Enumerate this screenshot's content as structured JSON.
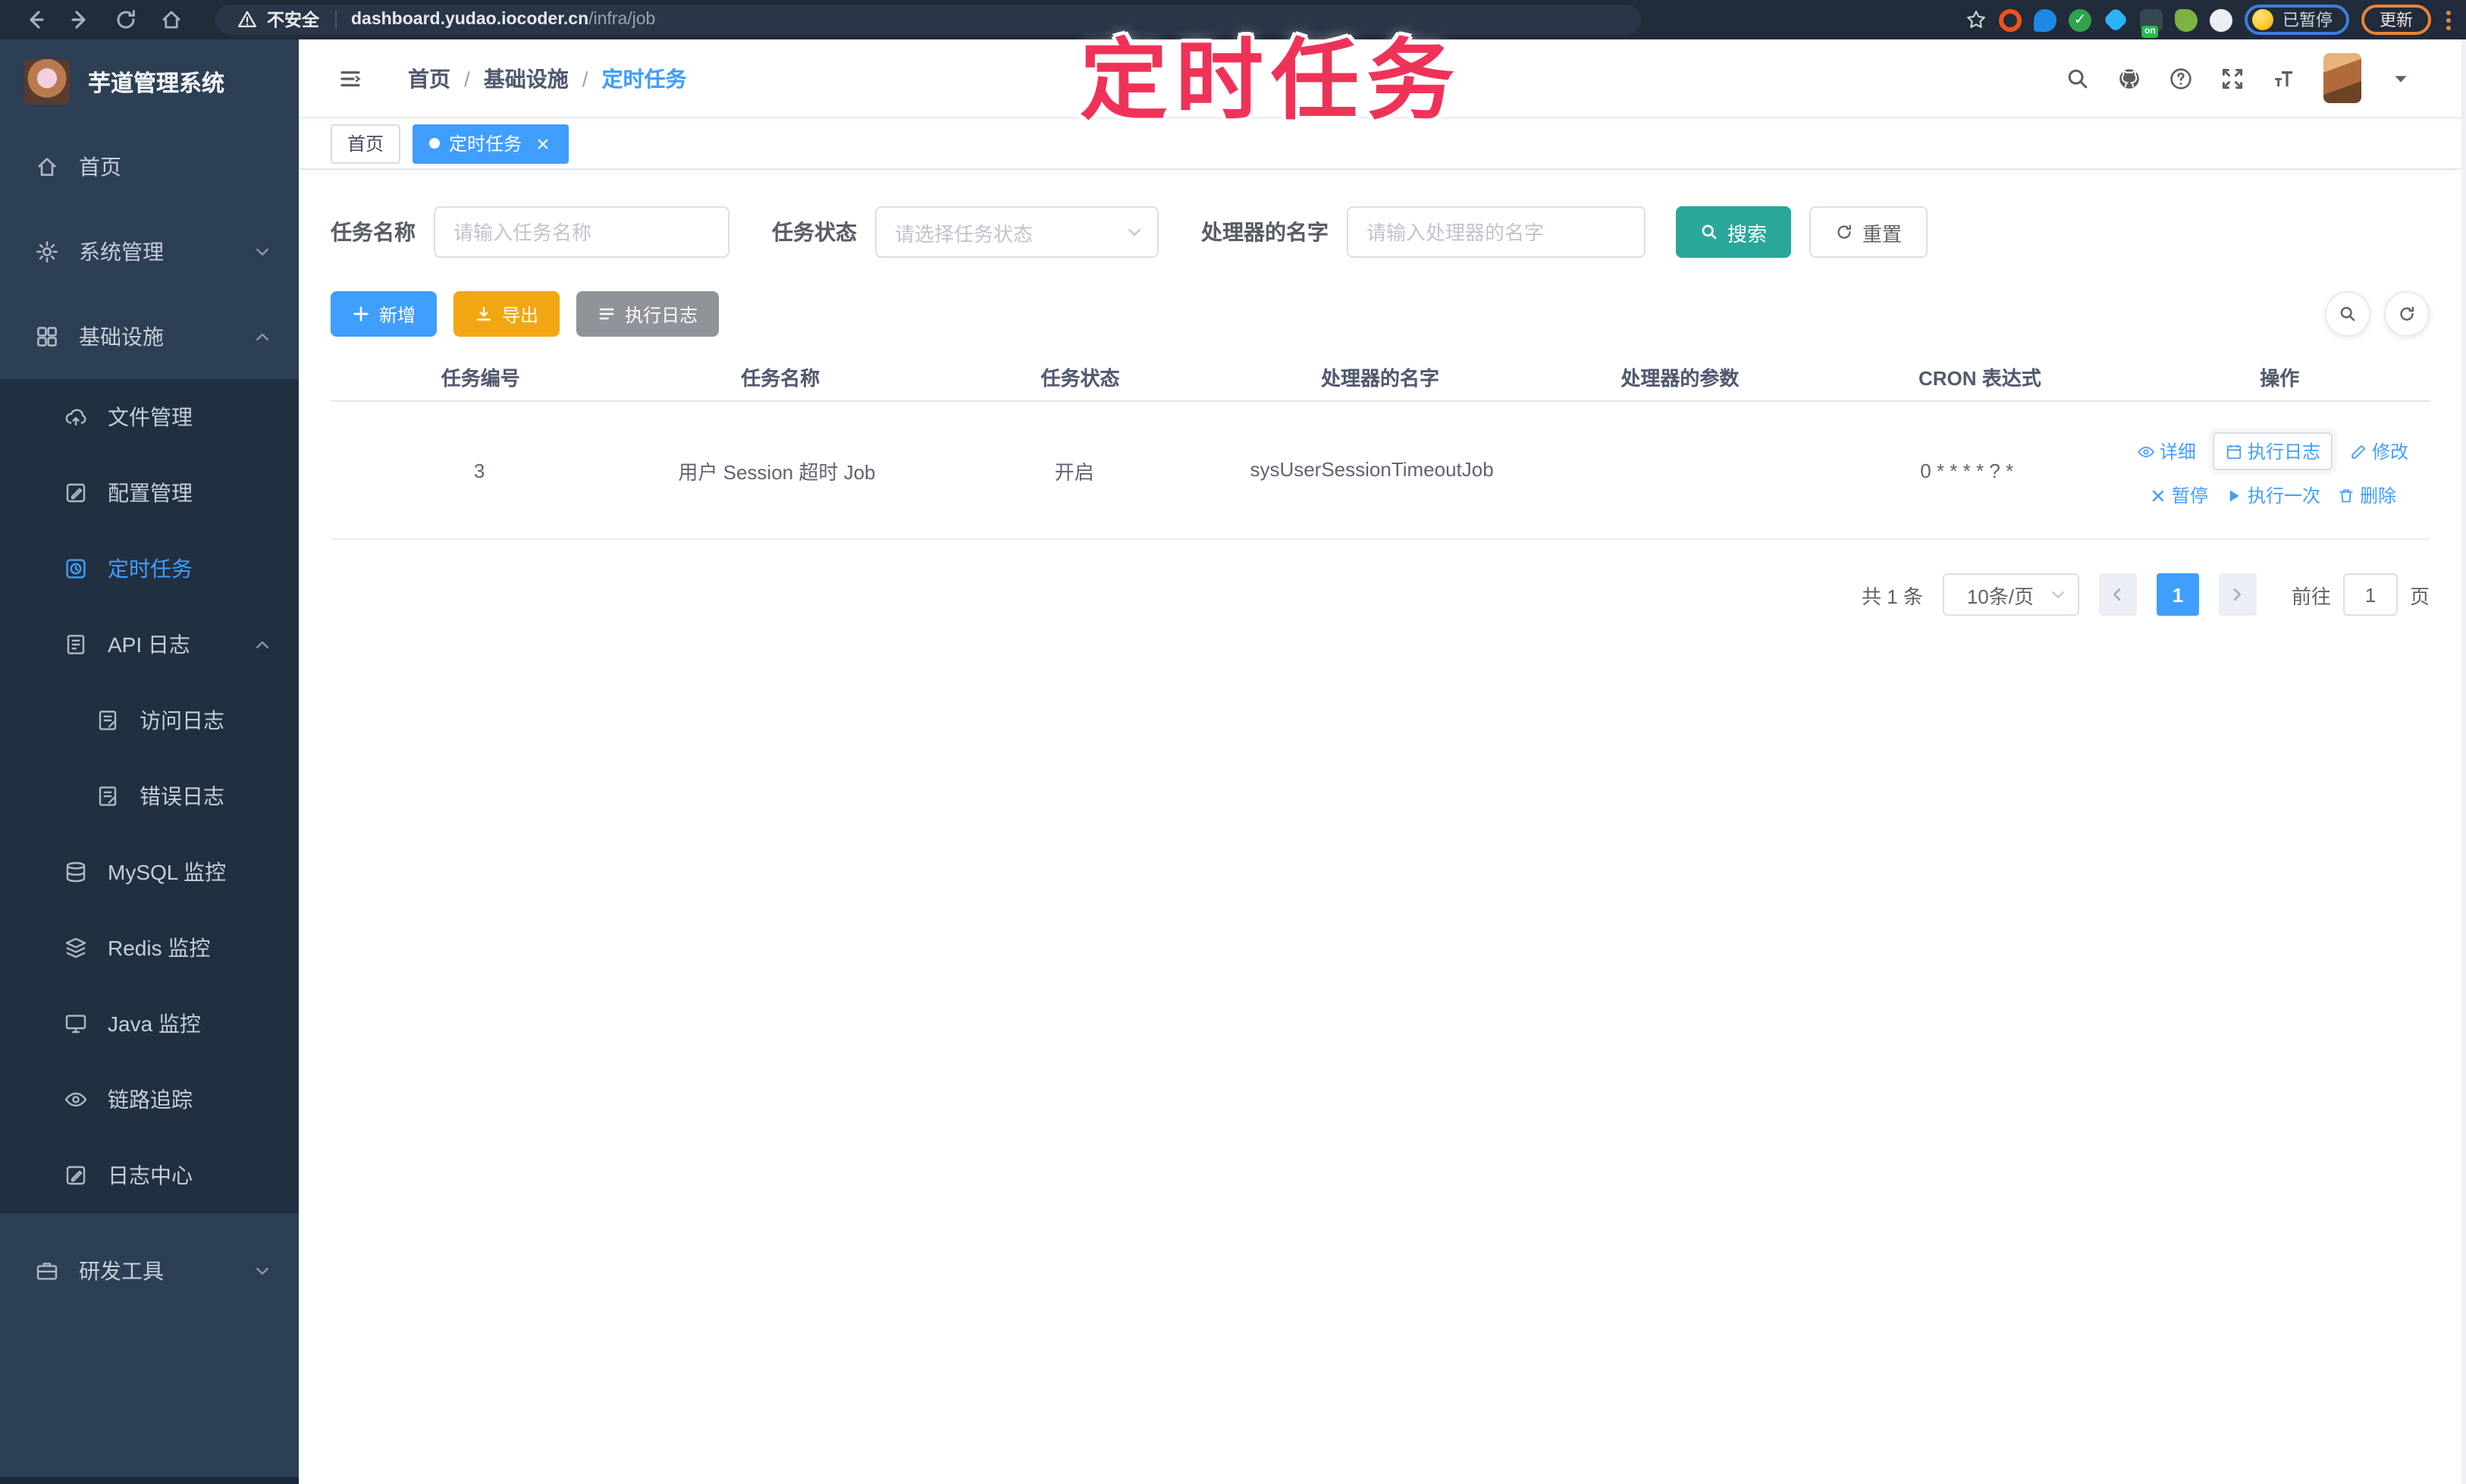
{
  "annotation": {
    "text": "定时任务",
    "color": "#ef3358"
  },
  "browser": {
    "security_label": "不安全",
    "url_host": "dashboard.yudao.iocoder.cn",
    "url_path": "/infra/job",
    "extension_on_badge": "on",
    "extension_check_glyph": "✓",
    "paused_badge": "已暂停",
    "update_button": "更新"
  },
  "sidebar": {
    "app_title": "芋道管理系统",
    "items": [
      {
        "label": "首页"
      },
      {
        "label": "系统管理"
      },
      {
        "label": "基础设施"
      },
      {
        "label": "文件管理"
      },
      {
        "label": "配置管理"
      },
      {
        "label": "定时任务"
      },
      {
        "label": "API 日志"
      },
      {
        "label": "访问日志"
      },
      {
        "label": "错误日志"
      },
      {
        "label": "MySQL 监控"
      },
      {
        "label": "Redis 监控"
      },
      {
        "label": "Java 监控"
      },
      {
        "label": "链路追踪"
      },
      {
        "label": "日志中心"
      },
      {
        "label": "研发工具"
      }
    ]
  },
  "header": {
    "breadcrumb": [
      {
        "label": "首页"
      },
      {
        "label": "基础设施"
      },
      {
        "label": "定时任务"
      }
    ],
    "breadcrumb_sep": "/"
  },
  "tags": [
    {
      "label": "首页"
    },
    {
      "label": "定时任务"
    }
  ],
  "filters": {
    "name_label": "任务名称",
    "name_placeholder": "请输入任务名称",
    "status_label": "任务状态",
    "status_placeholder": "请选择任务状态",
    "handler_label": "处理器的名字",
    "handler_placeholder": "请输入处理器的名字",
    "search_label": "搜索",
    "reset_label": "重置"
  },
  "toolbar": {
    "add_label": "新增",
    "export_label": "导出",
    "log_label": "执行日志"
  },
  "table": {
    "columns": [
      {
        "label": "任务编号"
      },
      {
        "label": "任务名称"
      },
      {
        "label": "任务状态"
      },
      {
        "label": "处理器的名字"
      },
      {
        "label": "处理器的参数"
      },
      {
        "label": "CRON 表达式"
      },
      {
        "label": "操作"
      }
    ],
    "rows": [
      {
        "id": "3",
        "name": "用户 Session 超时 Job",
        "status": "开启",
        "handler": "sysUserSessionTimeoutJob",
        "params": "",
        "cron": "0 * * * * ? *"
      }
    ],
    "actions_row1": [
      {
        "label": "详细"
      },
      {
        "label": "执行日志"
      },
      {
        "label": "修改"
      }
    ],
    "actions_row2": [
      {
        "label": "暂停"
      },
      {
        "label": "执行一次"
      },
      {
        "label": "删除"
      }
    ]
  },
  "pagination": {
    "total": "共 1 条",
    "page_size": "10条/页",
    "page": "1",
    "goto_label": "前往",
    "goto_value": "1",
    "page_unit": "页"
  },
  "colors": {
    "accent_blue": "#409EFF",
    "search_teal": "#2aa79b",
    "export_orange": "#f2a712",
    "info_gray": "#909399",
    "sidebar_bg": "#2d3f55",
    "submenu_bg": "#213040",
    "chrome_bg": "#212b3a",
    "annotation_pink": "#ef3358"
  }
}
